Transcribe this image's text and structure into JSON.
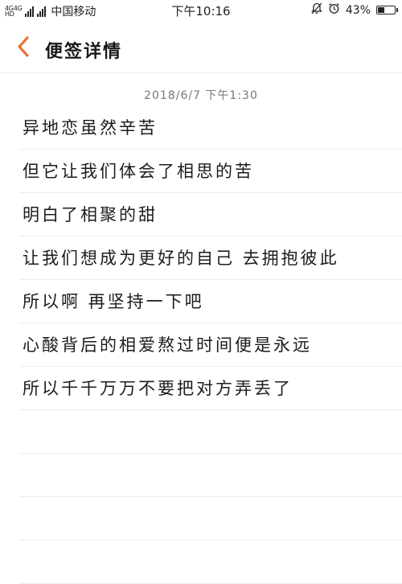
{
  "status_bar": {
    "net_top": "4G",
    "net_top2": "4G",
    "net_sub": "HD",
    "carrier": "中国移动",
    "time": "下午10:16",
    "battery_pct": "43%",
    "battery_level": 0.43
  },
  "header": {
    "back_icon": "chevron-left-icon",
    "title": "便签详情",
    "accent_color": "#e8743b"
  },
  "note": {
    "date": "2018/6/7 下午1:30",
    "lines": [
      "异地恋虽然辛苦",
      "但它让我们体会了相思的苦",
      "明白了相聚的甜",
      "让我们想成为更好的自己 去拥抱彼此",
      "所以啊 再坚持一下吧",
      "心酸背后的相爱熬过时间便是永远",
      "所以千千万万不要把对方弄丢了",
      "",
      "",
      "",
      ""
    ]
  }
}
